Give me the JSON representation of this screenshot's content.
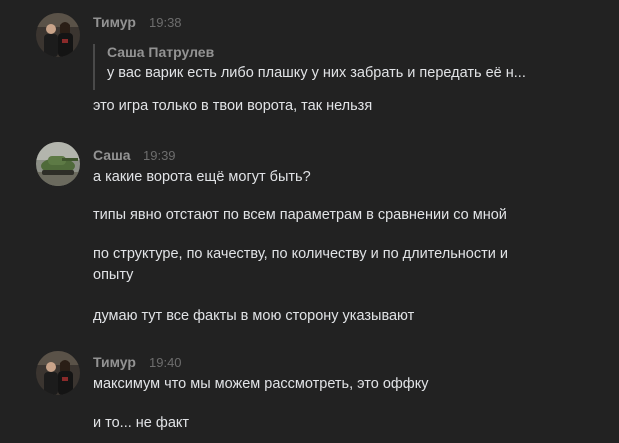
{
  "messages": [
    {
      "author": "Тимур",
      "time": "19:38",
      "avatar_icon": "two-people-photo-icon",
      "quote": {
        "author": "Саша Патрулев",
        "text": "у вас варик есть либо плашку у них забрать и передать её н..."
      },
      "lines": [
        "это игра только в твои ворота, так нельзя"
      ]
    },
    {
      "author": "Саша",
      "time": "19:39",
      "avatar_icon": "tank-photo-icon",
      "lines": [
        "а какие ворота ещё могут быть?",
        "типы явно отстают по всем параметрам в сравнении со мной",
        "по структуре, по качеству, по количеству и по длительности и",
        "опыту",
        "думаю тут все факты в мою сторону указывают"
      ]
    },
    {
      "author": "Тимур",
      "time": "19:40",
      "avatar_icon": "two-people-photo-icon",
      "lines": [
        "максимум что мы можем рассмотреть, это оффку",
        "и то... не факт"
      ]
    }
  ],
  "colors": {
    "background": "#222222",
    "author": "#939393",
    "time": "#6d6d6d",
    "text": "#e1e3e6",
    "quote_border": "#4a4a4a"
  }
}
